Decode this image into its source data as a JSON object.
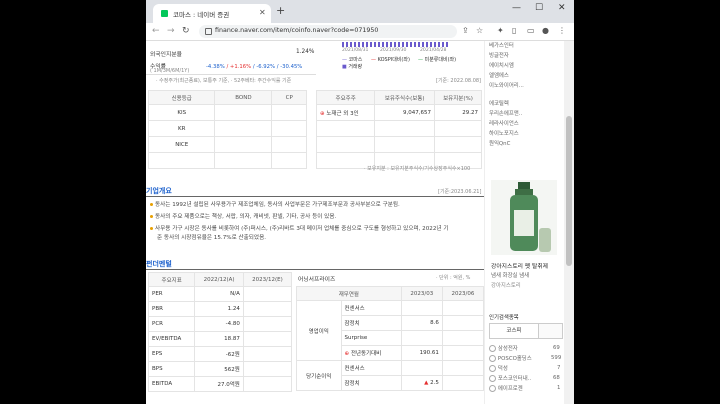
{
  "browser": {
    "tab_title": "코마스 : 네이버 증권",
    "url": "finance.naver.com/item/coinfo.naver?code=071950"
  },
  "top": {
    "foreign_label": "외국인지분율",
    "foreign_value": "1.24%",
    "return_label": "수익률",
    "return_sub": "( 1M/3M/6M/1Y)",
    "return_values": [
      "-4.38%",
      "/ +1.16%",
      "/ -6.92%",
      "/ -30.45%"
    ],
    "note": "· 수정주가(최근종료), 보통주 기준, · 52주베타: 주간수익률 기준",
    "base_date": "[기준: 2022.08.08]"
  },
  "chart_mini": {
    "dates": [
      "2021/08/31",
      "2021/09/30",
      "2021/04/28"
    ],
    "legend": [
      "코마스",
      "KOSPI대비(좌)",
      "미분류대비(좌)",
      "거래량"
    ]
  },
  "credit_table": {
    "headers": [
      "신용등급",
      "BOND",
      "CP"
    ],
    "rows": [
      "KIS",
      "KR",
      "NICE",
      ""
    ]
  },
  "holder_table": {
    "headers": [
      "주요주주",
      "보유주식수(보통)",
      "보유지분(%)"
    ],
    "rows": [
      {
        "name": "노재근 외 3인",
        "shares": "9,047,657",
        "pct": "29.27"
      }
    ],
    "note": "· 보유지분 : 보유지분주식수/기수상장주식수×100"
  },
  "company": {
    "title": "기업개요",
    "date": "[기준:2023.06.21]",
    "bullets": [
      "동사는 1992년 설립된 사무용가구 제조업체임, 동사의 사업부문은 가구제조부문과 공사부분으로 구분됨.",
      "동사의 주요 제품으로는 책상, 서랍, 의자, 캐비넷, 판넬, 기타, 공사 등이 있음.",
      "사무용 가구 시장은 동사를 비롯하여 (주)퍼시스, (주)리바트 3대 메이저 업체를 중심으로 구도를 형성하고 있으며, 2022년 기",
      "준 동사의 시장점유율은 15.7%로 산출되었음."
    ]
  },
  "fundamental": {
    "title": "펀더멘털",
    "headers": [
      "주요지표",
      "2022/12(A)",
      "2023/12(E)"
    ],
    "rows": [
      {
        "k": "PER",
        "a": "N/A",
        "e": ""
      },
      {
        "k": "PBR",
        "a": "1.24",
        "e": ""
      },
      {
        "k": "PCR",
        "a": "-4.80",
        "e": ""
      },
      {
        "k": "EV/EBITDA",
        "a": "18.87",
        "e": ""
      },
      {
        "k": "EPS",
        "a": "-62원",
        "e": ""
      },
      {
        "k": "BPS",
        "a": "562원",
        "e": ""
      },
      {
        "k": "EBITDA",
        "a": "27.0억원",
        "e": ""
      }
    ]
  },
  "surprise": {
    "title": "어닝서프라이즈",
    "unit": "· 단위 : 억원, %",
    "col_headers": [
      "재무연월",
      "2023/03",
      "2023/06"
    ],
    "group1": "영업이익",
    "group2": "당기순이익",
    "rows": [
      {
        "k": "컨센서스",
        "v1": "",
        "v2": ""
      },
      {
        "k": "잠정치",
        "v1": "8.6",
        "v2": ""
      },
      {
        "k": "Surprise",
        "v1": "",
        "v2": ""
      },
      {
        "k": "전년동기대비",
        "v1": "190.61",
        "v2": ""
      },
      {
        "k": "컨센서스",
        "v1": "",
        "v2": ""
      },
      {
        "k": "잠정치",
        "v1": "2.5",
        "v2": ""
      }
    ]
  },
  "sidebar": {
    "top_items": [
      "베가스인터",
      "빙글전자",
      "에이치시엠",
      "엘엠에스",
      "이노와이어리..."
    ],
    "mid_items": [
      "에코릴렉",
      "우리손에프앤..",
      "레라사이언스",
      "하이노포지스",
      "원익QnC"
    ],
    "ad_title": "강아지스토리 펫 탈취제",
    "ad_line2": "냄새 화장실 냄새",
    "ad_line3": "강아지스토리",
    "popular_title": "인기검색종목",
    "popular_tab": "코스피",
    "popular": [
      {
        "name": "삼성전자",
        "val": "69"
      },
      {
        "name": "POSCO홀딩스",
        "val": "599"
      },
      {
        "name": "덕성",
        "val": "7"
      },
      {
        "name": "포스코인터내..",
        "val": "68"
      },
      {
        "name": "에이프로젠",
        "val": "1"
      }
    ]
  }
}
